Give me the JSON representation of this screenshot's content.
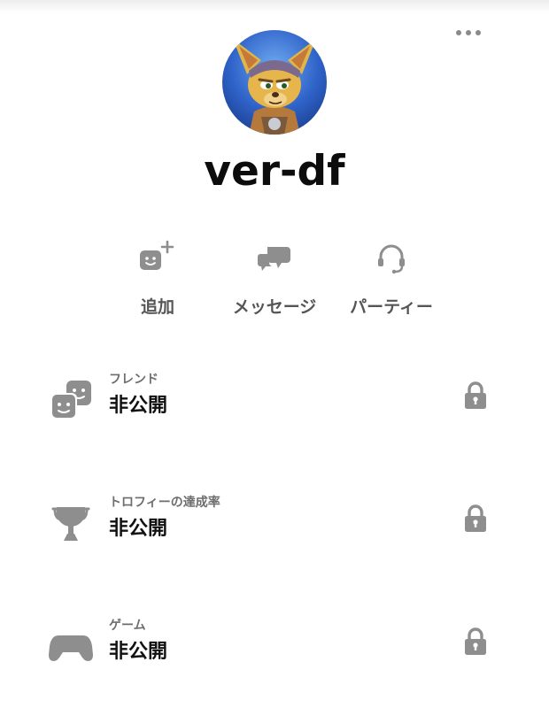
{
  "profile": {
    "username": "ver-df",
    "more_menu": "more-horizontal-icon"
  },
  "actions": [
    {
      "label": "追加",
      "icon": "add-friend-icon"
    },
    {
      "label": "メッセージ",
      "icon": "message-icon"
    },
    {
      "label": "パーティー",
      "icon": "headset-icon"
    }
  ],
  "privacy": [
    {
      "label": "フレンド",
      "value": "非公開",
      "icon": "friends-icon"
    },
    {
      "label": "トロフィーの達成率",
      "value": "非公開",
      "icon": "trophy-icon"
    },
    {
      "label": "ゲーム",
      "value": "非公開",
      "icon": "gamepad-icon"
    }
  ],
  "colors": {
    "icon_gray": "#8e8e8e",
    "text_dark": "#111111",
    "label_gray": "#6d6d6d"
  }
}
